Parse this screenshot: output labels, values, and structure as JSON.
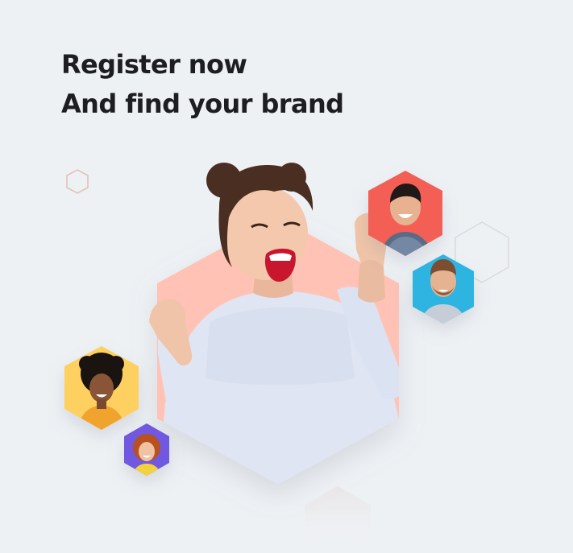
{
  "headline": {
    "line1": "Register now",
    "line2": "And find your brand"
  },
  "colors": {
    "background": "#eef1f4",
    "text": "#1d1e22",
    "main_hexagon": "#ffc2b5",
    "accent_red": "#f35f55",
    "accent_blue": "#2fb4e0",
    "accent_yellow": "#fdd05e",
    "accent_purple": "#6f59e0",
    "hexagon_outline": "#d9d9dc"
  },
  "images": [
    {
      "name": "celebrating-woman-photo",
      "description": "Excited woman with hair buns cheering with raised fists"
    },
    {
      "name": "smiling-man-checked-shirt-avatar",
      "background": "red"
    },
    {
      "name": "bearded-man-avatar",
      "background": "blue"
    },
    {
      "name": "curly-haired-woman-avatar",
      "background": "yellow"
    },
    {
      "name": "redhead-woman-avatar",
      "background": "purple"
    }
  ]
}
